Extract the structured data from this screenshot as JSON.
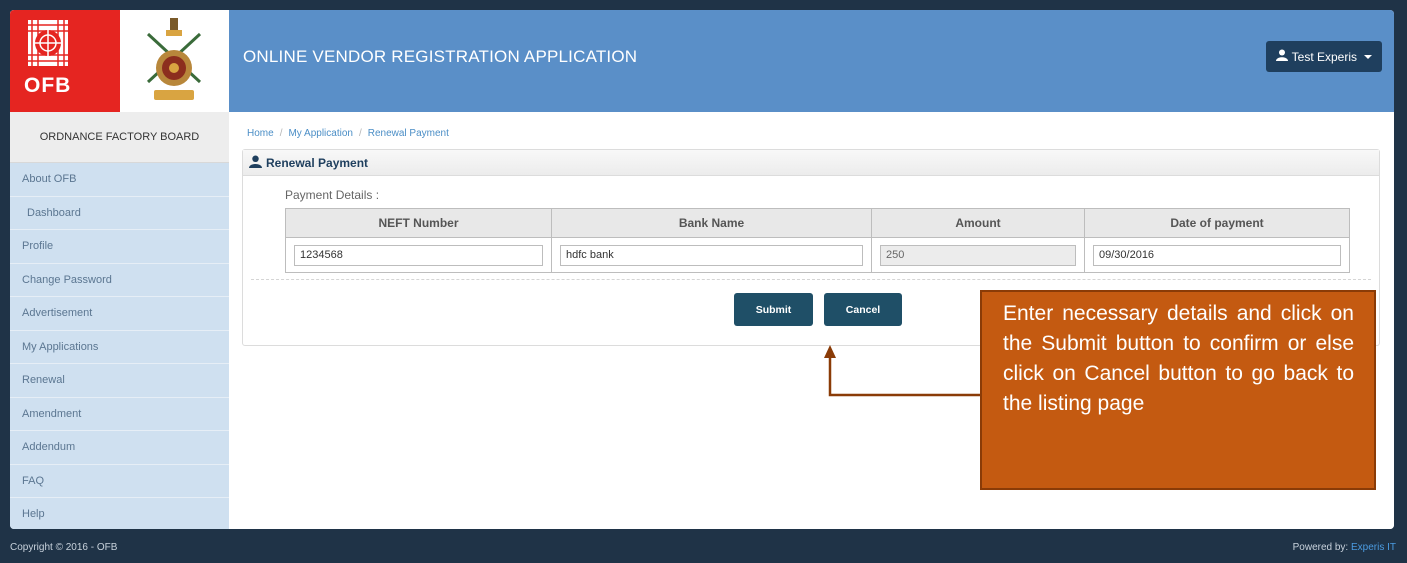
{
  "header": {
    "logo_text": "OFB",
    "app_title": "ONLINE VENDOR REGISTRATION APPLICATION",
    "user_label": "Test Experis",
    "user_icon": "user-icon",
    "accent_color": "#5a8fc8"
  },
  "sidebar": {
    "title": "ORDNANCE FACTORY BOARD",
    "items": [
      {
        "label": "About OFB"
      },
      {
        "label": "Dashboard"
      },
      {
        "label": "Profile"
      },
      {
        "label": "Change Password"
      },
      {
        "label": "Advertisement"
      },
      {
        "label": "My Applications"
      },
      {
        "label": "Renewal"
      },
      {
        "label": "Amendment"
      },
      {
        "label": "Addendum"
      },
      {
        "label": "FAQ"
      },
      {
        "label": "Help"
      }
    ]
  },
  "breadcrumb": {
    "items": [
      "Home",
      "My Application",
      "Renewal Payment"
    ]
  },
  "panel": {
    "title": "Renewal Payment",
    "section_label": "Payment Details :",
    "columns": [
      "NEFT Number",
      "Bank Name",
      "Amount",
      "Date of payment"
    ],
    "values": {
      "neft_number": "1234568",
      "bank_name": "hdfc bank",
      "amount": "250",
      "date_of_payment": "09/30/2016"
    },
    "submit_label": "Submit",
    "cancel_label": "Cancel"
  },
  "callout": {
    "text": "Enter necessary details and click on the Submit button to confirm or else click on Cancel button to go back to the listing page",
    "color": "#c45a11"
  },
  "footer": {
    "copyright": "Copyright © 2016 - OFB",
    "powered_prefix": "Powered by: ",
    "powered_brand": "Experis IT"
  }
}
